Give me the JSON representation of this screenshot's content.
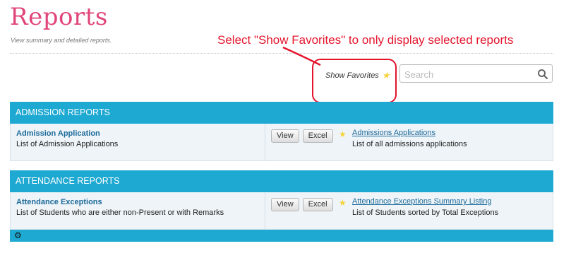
{
  "header": {
    "title": "Reports",
    "subtitle": "View summary and detailed reports."
  },
  "annotation": {
    "text": "Select \"Show Favorites\" to only display selected reports",
    "color": "#e3142c"
  },
  "toolbar": {
    "show_favorites_label": "Show Favorites",
    "search_placeholder": "Search",
    "search_value": ""
  },
  "colors": {
    "accent": "#1ea9d2",
    "title": "#e0457b",
    "link": "#1d6a9a",
    "star": "#f5d33a"
  },
  "sections": [
    {
      "title": "ADMISSION REPORTS",
      "reports": [
        {
          "name": "Admission Application",
          "description": "List of Admission Applications",
          "view_label": "View",
          "excel_label": "Excel",
          "favorite_title": "Admissions Applications",
          "favorite_description": "List of all admissions applications"
        }
      ]
    },
    {
      "title": "ATTENDANCE REPORTS",
      "reports": [
        {
          "name": "Attendance Exceptions",
          "description": "List of Students who are either non-Present or with Remarks",
          "view_label": "View",
          "excel_label": "Excel",
          "favorite_title": "Attendance Exceptions Summary Listing",
          "favorite_description": "List of Students sorted by Total Exceptions"
        }
      ]
    }
  ],
  "icons": {
    "search": "search-icon",
    "star": "star-icon",
    "gear": "gear-icon"
  }
}
